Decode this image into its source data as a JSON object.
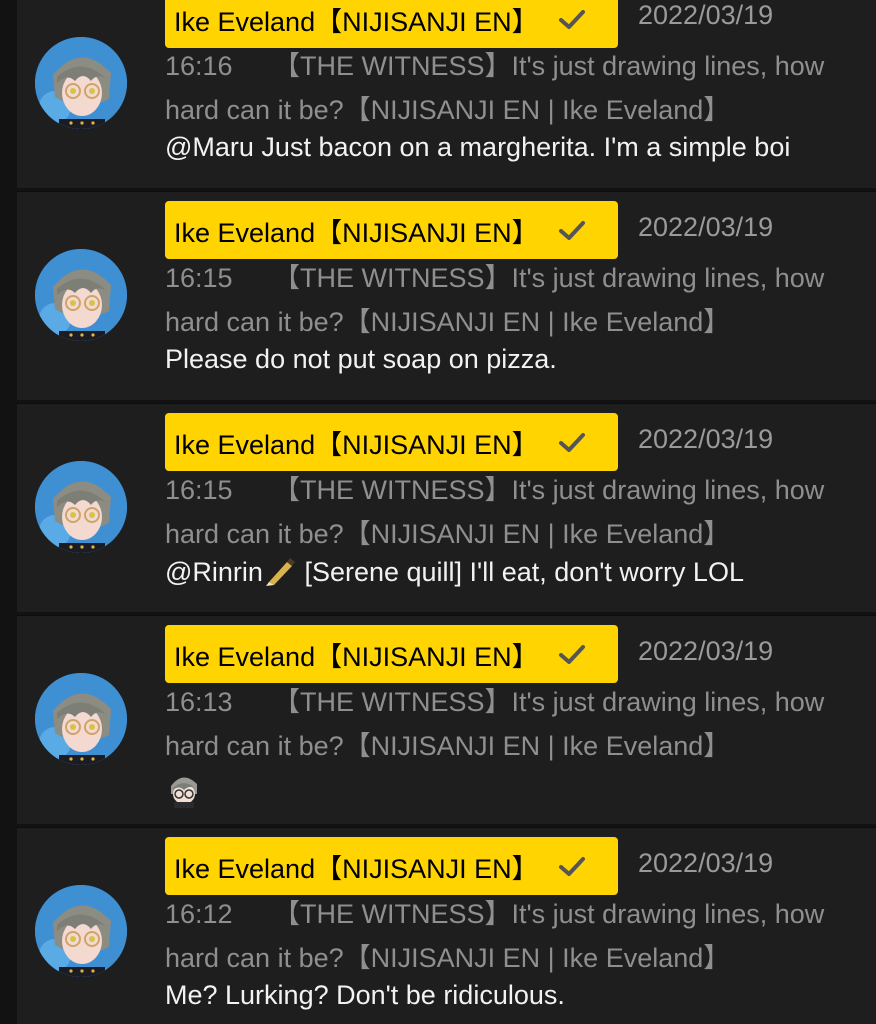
{
  "messages": [
    {
      "author": "Ike Eveland【NIJISANJI EN】",
      "date": "2022/03/19",
      "time": "16:16",
      "stream_title_1": "【THE WITNESS】It's just drawing lines, how",
      "stream_title_2": "hard can it be?【NIJISANJI EN | Ike Eveland】",
      "text": "@Maru Just bacon on a margherita. I'm a simple boi"
    },
    {
      "author": "Ike Eveland【NIJISANJI EN】",
      "date": "2022/03/19",
      "time": "16:15",
      "stream_title_1": "【THE WITNESS】It's just drawing lines, how",
      "stream_title_2": "hard can it be?【NIJISANJI EN | Ike Eveland】",
      "text": "Please do not put soap on pizza."
    },
    {
      "author": "Ike Eveland【NIJISANJI EN】",
      "date": "2022/03/19",
      "time": "16:15",
      "stream_title_1": "【THE WITNESS】It's just drawing lines, how",
      "stream_title_2": "hard can it be?【NIJISANJI EN | Ike Eveland】",
      "text_before_icon": "@Rinrin",
      "text_after_icon": " [Serene quill] I'll eat, don't worry LOL",
      "inline_icon": "fountain-pen-icon"
    },
    {
      "author": "Ike Eveland【NIJISANJI EN】",
      "date": "2022/03/19",
      "time": "16:13",
      "stream_title_1": "【THE WITNESS】It's just drawing lines, how",
      "stream_title_2": "hard can it be?【NIJISANJI EN | Ike Eveland】",
      "sticker": "ike-emote-sticker"
    },
    {
      "author": "Ike Eveland【NIJISANJI EN】",
      "date": "2022/03/19",
      "time": "16:12",
      "stream_title_1": "【THE WITNESS】It's just drawing lines, how",
      "stream_title_2": "hard can it be?【NIJISANJI EN | Ike Eveland】",
      "text": "Me? Lurking? Don't be ridiculous."
    }
  ],
  "colors": {
    "badge": "#ffd400",
    "avatar_bg": "#3f8fd3",
    "card_bg": "#1e1e1e",
    "meta_text": "#8f8f8f"
  },
  "icons": {
    "verified": "check-icon",
    "avatar": "avatar-portrait"
  }
}
